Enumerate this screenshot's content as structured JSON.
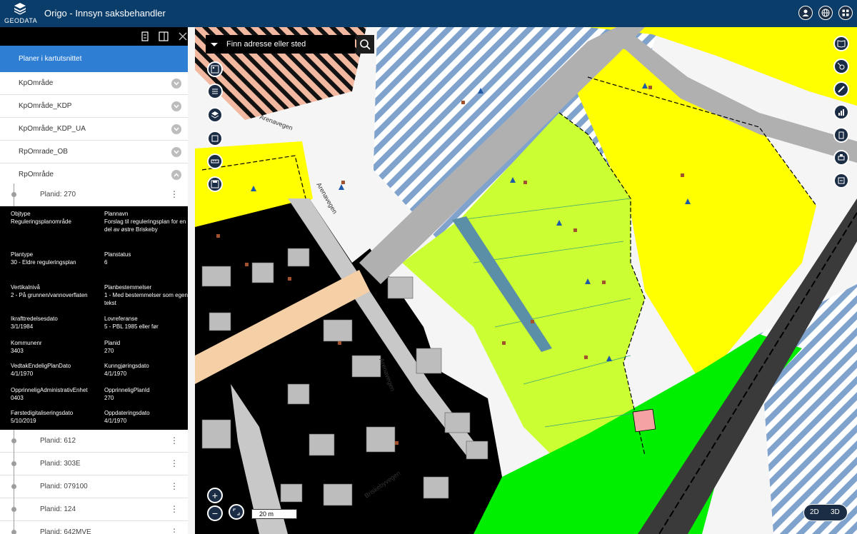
{
  "app": {
    "logo_text": "GEODATA",
    "title": "Origo - Innsyn saksbehandler"
  },
  "search": {
    "placeholder": "Finn adresse eller sted"
  },
  "sidebar": {
    "active_layer": "Planer i kartutsnittet",
    "groups": [
      {
        "label": "KpOmråde",
        "expanded": false
      },
      {
        "label": "KpOmråde_KDP",
        "expanded": false
      },
      {
        "label": "KpOmråde_KDP_UA",
        "expanded": false
      },
      {
        "label": "RpOmrade_OB",
        "expanded": false
      },
      {
        "label": "RpOmråde",
        "expanded": true
      }
    ],
    "selected_plan": "Planid: 270",
    "attributes": [
      {
        "key": "Objtype",
        "value": "Reguleringsplanområde"
      },
      {
        "key": "Plannavn",
        "value": "Forslag til reguleringsplan for en del av østre Briskeby"
      },
      {
        "key": "Plantype",
        "value": "30 - Eldre reguleringsplan"
      },
      {
        "key": "Planstatus",
        "value": "6"
      },
      {
        "key": "Vertikalnivå",
        "value": "2 - På grunnen/vannoverflaten"
      },
      {
        "key": "Planbestemmelser",
        "value": "1 - Med bestemmelser som egen tekst"
      },
      {
        "key": "Ikrafttredelsesdato",
        "value": "3/1/1984"
      },
      {
        "key": "Lovreferanse",
        "value": "5 - PBL 1985 eller før"
      },
      {
        "key": "Kommunenr",
        "value": "3403"
      },
      {
        "key": "Planid",
        "value": "270"
      },
      {
        "key": "VedtakEndeligPlanDato",
        "value": "4/1/1970"
      },
      {
        "key": "Kunngjøringsdato",
        "value": "4/1/1970"
      },
      {
        "key": "OpprinneligAdministrativEnhet",
        "value": "0403"
      },
      {
        "key": "OpprinneligPlanId",
        "value": "270"
      },
      {
        "key": "Førstedigitaliseringsdato",
        "value": "5/10/2019"
      },
      {
        "key": "Oppdateringsdato",
        "value": "4/1/1970"
      }
    ],
    "other_plans": [
      "Planid: 612",
      "Planid: 303E",
      "Planid: 079100",
      "Planid: 124",
      "Planid: 642MVE"
    ]
  },
  "map": {
    "road_labels": [
      "Arenavegen",
      "Arenavegen",
      "Arenavegen",
      "Briskebyvegen"
    ],
    "scale_label": "20 m",
    "view_2d": "2D",
    "view_3d": "3D",
    "zoom_in": "+",
    "zoom_out": "−"
  },
  "icons": {
    "search": "search-icon",
    "dropdown": "chevron-down-icon",
    "globe": "globe-icon",
    "user": "user-icon",
    "grid": "grid-icon"
  },
  "colors": {
    "header": "#0b3d6b",
    "active_row": "#2e7fd4",
    "map_button": "#1b2d44",
    "residential": "#ffff00",
    "green_zone": "#ccff33",
    "park": "#00ee00"
  }
}
